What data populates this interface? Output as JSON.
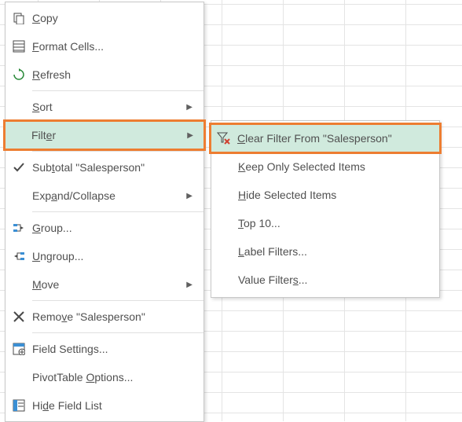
{
  "filter_field": "Salesperson",
  "main_menu": {
    "copy": {
      "pre": "",
      "u": "C",
      "post": "opy"
    },
    "format": {
      "pre": "",
      "u": "F",
      "post": "ormat Cells..."
    },
    "refresh": {
      "pre": "",
      "u": "R",
      "post": "efresh"
    },
    "sort": {
      "pre": "",
      "u": "S",
      "post": "ort"
    },
    "filter": {
      "pre": "Filt",
      "u": "e",
      "post": "r"
    },
    "subtotal": {
      "pre": "Sub",
      "u": "t",
      "post": "otal \"Salesperson\""
    },
    "expand": {
      "pre": "Exp",
      "u": "a",
      "post": "nd/Collapse"
    },
    "group": {
      "pre": "",
      "u": "G",
      "post": "roup..."
    },
    "ungroup": {
      "pre": "",
      "u": "U",
      "post": "ngroup..."
    },
    "move": {
      "pre": "",
      "u": "M",
      "post": "ove"
    },
    "remove": {
      "pre": "Remo",
      "u": "v",
      "post": "e \"Salesperson\""
    },
    "field_settings": {
      "pre": "Field Settings...",
      "u": "",
      "post": ""
    },
    "pivot_options": {
      "pre": "PivotTable ",
      "u": "O",
      "post": "ptions..."
    },
    "hide_field_list": {
      "pre": "Hi",
      "u": "d",
      "post": "e Field List"
    }
  },
  "sub_menu": {
    "clear": {
      "pre": "",
      "u": "C",
      "post": "lear Filter From \"Salesperson\""
    },
    "keep": {
      "pre": "",
      "u": "K",
      "post": "eep Only Selected Items"
    },
    "hide": {
      "pre": "",
      "u": "H",
      "post": "ide Selected Items"
    },
    "top10": {
      "pre": "",
      "u": "T",
      "post": "op 10..."
    },
    "label_f": {
      "pre": "",
      "u": "L",
      "post": "abel Filters..."
    },
    "value_f": {
      "pre": "Value Filter",
      "u": "s",
      "post": "..."
    }
  }
}
